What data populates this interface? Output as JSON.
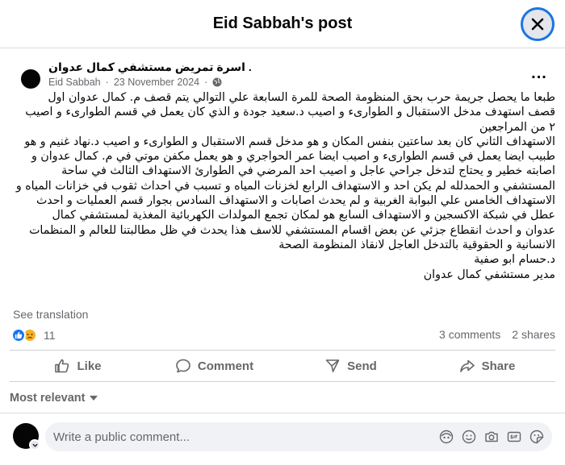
{
  "header": {
    "title": "Eid Sabbah's post"
  },
  "post": {
    "group_name": "اسرة تمريض مستشفي كمال عدوان .",
    "author": "Eid Sabbah",
    "date": "23 November 2024",
    "separator": "·",
    "privacy_icon": "globe-icon",
    "more_label": "...",
    "text_lines": [
      "طبعا ما يحصل جريمة حرب بحق المنظومة الصحة للمرة السابعة علي التوالي يتم قصف م. كمال عدوان اول",
      "قصف استهدف مدخل الاستقبال و الطوارىء و اصيب د.سعيد جودة و الذي كان يعمل في قسم الطوارىء و اصيب",
      "٢ من المراجعين",
      "الاستهداف الثاني كان بعد ساعتين بنفس المكان و هو مدخل قسم الاستقبال و الطوارىء و اصيب د.نهاد غنيم و هو",
      "طبيب ايضا يعمل في قسم الطوارىء و اصيب ايضا عمر الحواجري و هو يعمل مكفن موتي في م. كمال عدوان و",
      "اصابته خطير و يحتاج لتدخل جراحي عاجل و اصيب احد المرضي في الطوارئ الاستهداف الثالث في ساحة",
      "المستشفي و الحمدلله لم يكن احد و الاستهداف الرابع لخزنات المياه و تسبب في احداث ثقوب في خزانات المياه و",
      "الاستهداف الخامس علي البوابة الغربية و لم يحدث اصابات و الاستهداف السادس بجوار قسم العمليات و احدث",
      "عطل في شبكة الاكسجين و الاستهداف السابع هو لمكان تجمع المولدات الكهربائية المغذية لمستشفي كمال",
      "عدوان و احدث انقطاع جزئي عن بعض اقسام المستشفي للاسف هذا يحدث في ظل مطالبتنا للعالم و المنظمات",
      "الانسانية و الحقوقية بالتدخل العاجل لانقاذ المنظومة الصحة",
      "د.حسام ابو صفية",
      "مدير مستشفي كمال عدوان"
    ],
    "see_translation": "See translation",
    "reaction_count": "11",
    "comments_count": "3 comments",
    "shares_count": "2 shares"
  },
  "actions": {
    "like": "Like",
    "comment": "Comment",
    "send": "Send",
    "share": "Share"
  },
  "comments": {
    "sort_label": "Most relevant",
    "placeholder": "Write a public comment..."
  },
  "colors": {
    "accent": "#1877f2",
    "focus_ring": "#1b74e4",
    "muted_text": "#65676b"
  }
}
